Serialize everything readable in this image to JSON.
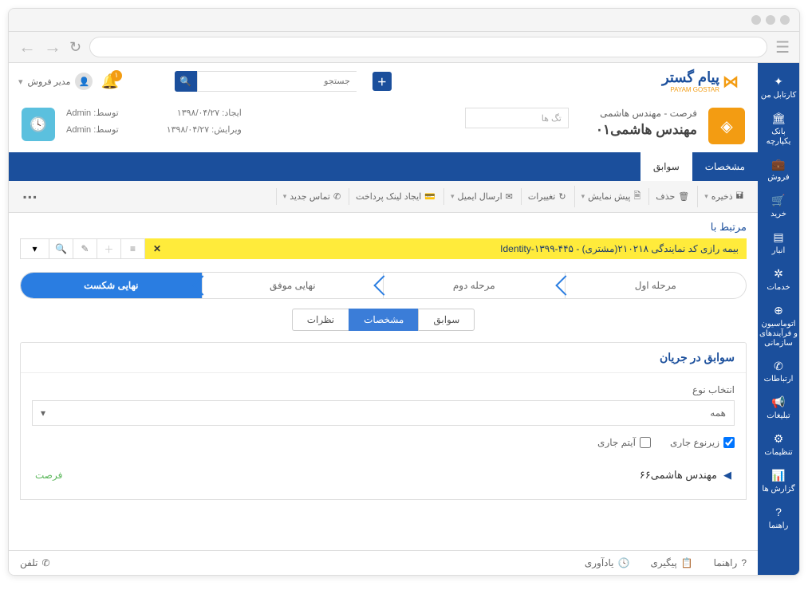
{
  "sidebar": {
    "items": [
      {
        "icon": "✦",
        "label": "کارتابل من"
      },
      {
        "icon": "🏛",
        "label": "بانک یکپارچه"
      },
      {
        "icon": "💼",
        "label": "فروش"
      },
      {
        "icon": "🛒",
        "label": "خرید"
      },
      {
        "icon": "▤",
        "label": "انبار"
      },
      {
        "icon": "⚙",
        "label": "خدمات"
      },
      {
        "icon": "⊕",
        "label": "اتوماسیون و فرآیندهای سازمانی"
      },
      {
        "icon": "☎",
        "label": "ارتباطات"
      },
      {
        "icon": "📢",
        "label": "تبلیغات"
      },
      {
        "icon": "⚙",
        "label": "تنظیمات"
      },
      {
        "icon": "📊",
        "label": "گزارش ها"
      },
      {
        "icon": "?",
        "label": "راهنما"
      }
    ]
  },
  "topbar": {
    "username": "مدیر فروش",
    "notif_count": "۱",
    "search_placeholder": "جستجو",
    "logo_text": "پیام گستر",
    "logo_sub": "PAYAM GOSTAR"
  },
  "record": {
    "breadcrumb": "فرصت -  مهندس هاشمی",
    "title": "مهندس هاشمی۰۱",
    "tags_placeholder": "تگ ها",
    "meta": {
      "created_label": "ایجاد:",
      "created_value": "۱۳۹۸/۰۴/۲۷",
      "edited_label": "ویرایش:",
      "edited_value": "۱۳۹۸/۰۴/۲۷",
      "by_label": "توسط:",
      "created_by": "Admin",
      "edited_by": "Admin"
    }
  },
  "tabs": {
    "items": [
      "مشخصات",
      "سوابق"
    ],
    "active": 1
  },
  "toolbar": {
    "save": "ذخیره",
    "delete": "حذف",
    "preview": "پیش نمایش",
    "changes": "تغییرات",
    "send_email": "ارسال ایمیل",
    "pay_link": "ایجاد لینک پرداخت",
    "new_call": "تماس جدید"
  },
  "related": {
    "label": "مرتبط با",
    "text": "بیمه رازی کد نمایندگی ۲۱۰۲۱۸(مشتری) - Identity-۱۳۹۹-۴۴۵"
  },
  "pipeline": {
    "stages": [
      "مرحله اول",
      "مرحله دوم",
      "نهایی موفق",
      "نهایی شکست"
    ],
    "active": 3
  },
  "subtabs": {
    "items": [
      "سوابق",
      "مشخصات",
      "نظرات"
    ],
    "active": 1
  },
  "panel": {
    "title": "سوابق در جریان",
    "type_label": "انتخاب نوع",
    "type_value": "همه",
    "chk1": "زیرنوع جاری",
    "chk2": "آیتم جاری",
    "result_name": "مهندس هاشمی۶۶",
    "result_tag": "فرصت"
  },
  "footer": {
    "help": "راهنما",
    "follow": "پیگیری",
    "remind": "یادآوری",
    "phone": "تلفن"
  }
}
